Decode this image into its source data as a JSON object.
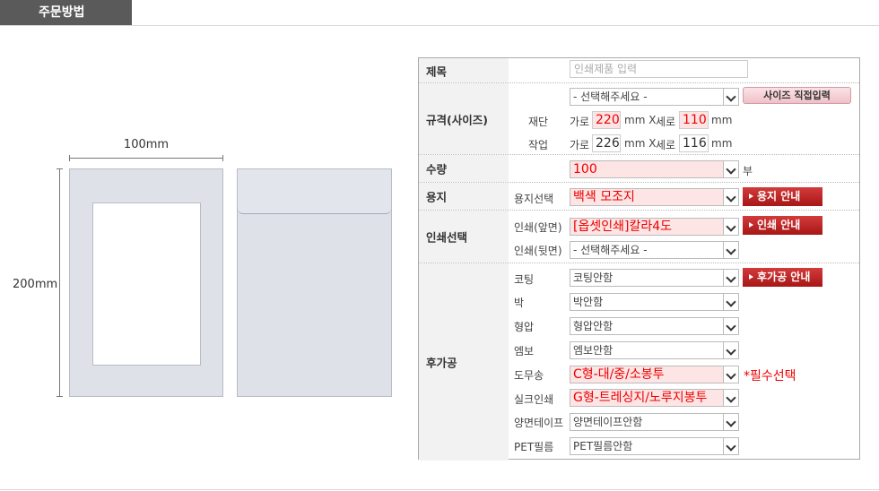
{
  "header": {
    "title": "주문방법"
  },
  "preview": {
    "width_label": "100mm",
    "height_label": "200mm"
  },
  "form": {
    "title": {
      "label": "제목",
      "placeholder": "인쇄제품 입력"
    },
    "size": {
      "label": "규격(사이즈)",
      "select_value": "- 선택해주세요 -",
      "direct_button": "사이즈 직접입력",
      "cut": {
        "label": "재단",
        "w_label": "가로",
        "w": "220",
        "unit1": "mm X",
        "h_label": "세로",
        "h": "110",
        "unit2": "mm"
      },
      "work": {
        "label": "작업",
        "w_label": "가로",
        "w": "226",
        "unit1": "mm X",
        "h_label": "세로",
        "h": "116",
        "unit2": "mm"
      }
    },
    "quantity": {
      "label": "수량",
      "value": "100",
      "unit": "부"
    },
    "paper": {
      "label": "용지",
      "sub_label": "용지선택",
      "value": "백색 모조지",
      "guide_button": "용지 안내"
    },
    "print": {
      "label": "인쇄선택",
      "front_label": "인쇄(앞면)",
      "front_value": "[옵셋인쇄]칼라4도",
      "guide_button": "인쇄 안내",
      "back_label": "인쇄(뒷면)",
      "back_value": "- 선택해주세요 -"
    },
    "post": {
      "label": "후가공",
      "guide_button": "후가공 안내",
      "required_note": "*필수선택",
      "items": [
        {
          "label": "코팅",
          "value": "코팅안함"
        },
        {
          "label": "박",
          "value": "박안함"
        },
        {
          "label": "형압",
          "value": "형압안함"
        },
        {
          "label": "엠보",
          "value": "엠보안함"
        },
        {
          "label": "도무송",
          "value": "C형-대/중/소봉투"
        },
        {
          "label": "실크인쇄",
          "value": "G형-트레싱지/노루지봉투"
        },
        {
          "label": "양면테이프",
          "value": "양면테이프안함"
        },
        {
          "label": "PET필름",
          "value": "PET필름안함"
        }
      ]
    }
  },
  "colors": {
    "accent_red": "#e00000",
    "highlight_bg": "#fde5e5",
    "button_red": "#b71c1c"
  }
}
